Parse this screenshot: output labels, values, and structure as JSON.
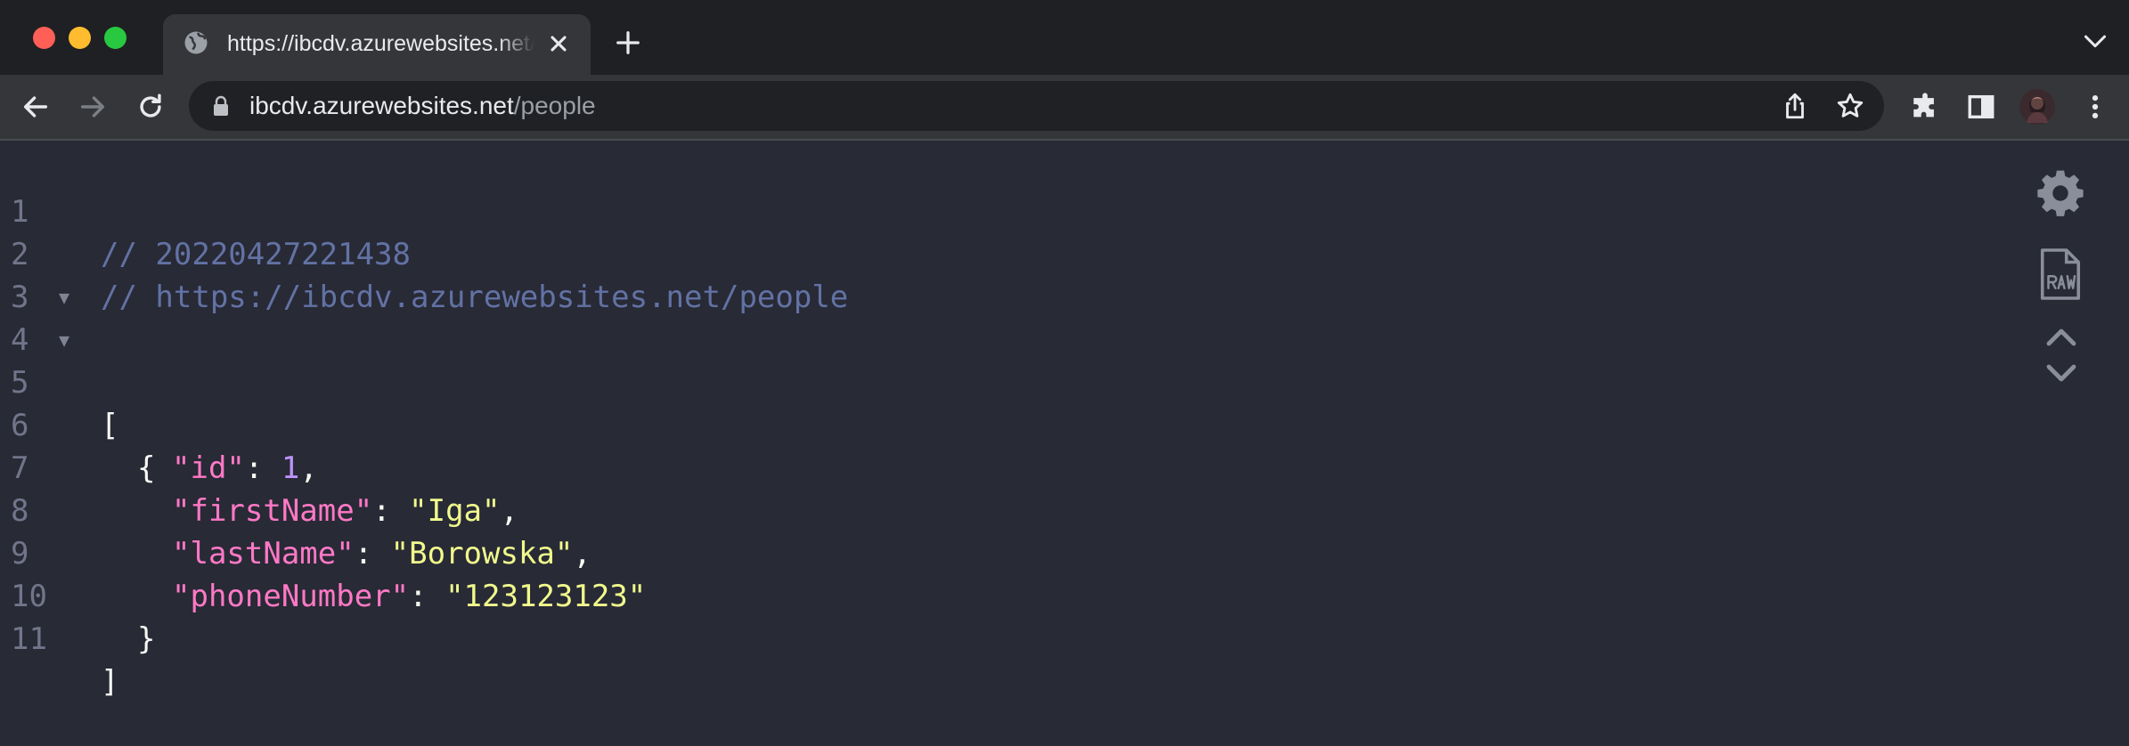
{
  "window": {
    "tab_title": "https://ibcdv.azurewebsites.net/people",
    "colors": {
      "close": "#ff5f57",
      "minimize": "#febc2e",
      "zoom": "#28c840"
    }
  },
  "toolbar": {
    "url_host": "ibcdv.azurewebsites.net",
    "url_path": "/people"
  },
  "icons": {
    "tab_favicon": "globe-icon",
    "back": "arrow-left-icon",
    "forward": "arrow-right-icon",
    "reload": "reload-icon",
    "share": "share-icon",
    "bookmark": "star-icon",
    "extensions": "puzzle-icon",
    "side_panel": "side-panel-icon",
    "profile": "avatar",
    "menu": "kebab-menu-icon",
    "viewer_settings": "gear-icon",
    "viewer_raw": "raw-file-icon",
    "viewer_toggle": "chevron-up-down-icon"
  },
  "viewer": {
    "line_numbers": [
      "1",
      "2",
      "3",
      "4",
      "5",
      "6",
      "7",
      "8",
      "9",
      "10",
      "11"
    ],
    "comment_timestamp": "// 20220427221438",
    "comment_url": "// https://ibcdv.azurewebsites.net/people",
    "open_bracket": "[",
    "open_brace": "{",
    "close_brace": "}",
    "close_bracket": "]",
    "fields": [
      {
        "key": "\"id\"",
        "value": "1",
        "value_type": "number",
        "suffix": ","
      },
      {
        "key": "\"firstName\"",
        "value": "\"Iga\"",
        "value_type": "string",
        "suffix": ","
      },
      {
        "key": "\"lastName\"",
        "value": "\"Borowska\"",
        "value_type": "string",
        "suffix": ","
      },
      {
        "key": "\"phoneNumber\"",
        "value": "\"123123123\"",
        "value_type": "string",
        "suffix": ""
      }
    ],
    "colors": {
      "background": "#282a36",
      "comment": "#6272a4",
      "key": "#ff79c6",
      "string": "#f1fa8c",
      "number": "#bd93f9"
    }
  }
}
